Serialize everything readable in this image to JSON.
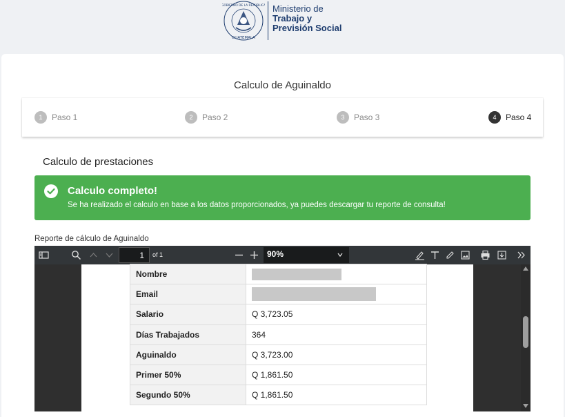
{
  "header": {
    "logo_seal_text": "GOBIERNO DE LA REPÚBLICA · GUATEMALA",
    "ministry_line1": "Ministerio de",
    "ministry_line2": "Trabajo y",
    "ministry_line3": "Previsión Social",
    "brand_color": "#1d3c6e"
  },
  "page": {
    "title": "Calculo de Aguinaldo"
  },
  "stepper": {
    "steps": [
      {
        "num": "1",
        "label": "Paso 1",
        "active": false
      },
      {
        "num": "2",
        "label": "Paso 2",
        "active": false
      },
      {
        "num": "3",
        "label": "Paso 3",
        "active": false
      },
      {
        "num": "4",
        "label": "Paso 4",
        "active": true
      }
    ]
  },
  "section": {
    "title": "Calculo de prestaciones"
  },
  "alert": {
    "title": "Calculo completo!",
    "message": "Se ha realizado el calculo en base a los datos proporcionados, ya puedes descargar tu reporte de consulta!",
    "color": "#4caf50",
    "icon": "check-circle-icon"
  },
  "report": {
    "label": "Reporte de cálculo de Aguinaldo",
    "toolbar": {
      "page_value": "1",
      "page_total": "of 1",
      "zoom_value": "90%",
      "icons": [
        "sidebar-toggle-icon",
        "search-icon",
        "chevron-up-icon",
        "chevron-down-icon",
        "minus-icon",
        "plus-icon",
        "highlighter-icon",
        "text-icon",
        "draw-icon",
        "image-icon",
        "print-icon",
        "download-icon",
        "more-icon"
      ]
    },
    "rows": [
      {
        "key": "Nombre",
        "value": "",
        "redacted": true
      },
      {
        "key": "Email",
        "value": "",
        "redacted": true
      },
      {
        "key": "Salario",
        "value": "Q 3,723.05"
      },
      {
        "key": "Días Trabajados",
        "value": "364"
      },
      {
        "key": "Aguinaldo",
        "value": "Q 3,723.00"
      },
      {
        "key": "Primer 50%",
        "value": "Q 1,861.50"
      },
      {
        "key": "Segundo 50%",
        "value": "Q 1,861.50"
      }
    ]
  }
}
